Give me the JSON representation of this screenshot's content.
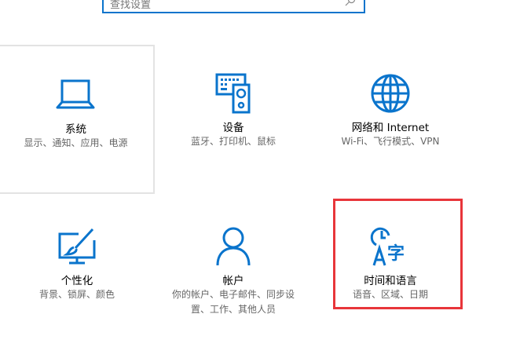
{
  "search": {
    "placeholder": "查找设置",
    "icon": "search-icon"
  },
  "tiles": [
    {
      "title": "系统",
      "subtitle": "显示、通知、应用、电源",
      "icon": "laptop-icon"
    },
    {
      "title": "设备",
      "subtitle": "蓝牙、打印机、鼠标",
      "icon": "devices-icon"
    },
    {
      "title": "网络和 Internet",
      "subtitle": "Wi-Fi、飞行模式、VPN",
      "icon": "globe-icon"
    },
    {
      "title": "个性化",
      "subtitle": "背景、锁屏、颜色",
      "icon": "paint-brush-icon"
    },
    {
      "title": "帐户",
      "subtitle": "你的帐户、电子邮件、同步设置、工作、其他人员",
      "icon": "person-icon"
    },
    {
      "title": "时间和语言",
      "subtitle": "语音、区域、日期",
      "icon": "time-language-icon"
    }
  ],
  "colors": {
    "accent": "#0a74cc",
    "highlight": "#e8353a"
  }
}
